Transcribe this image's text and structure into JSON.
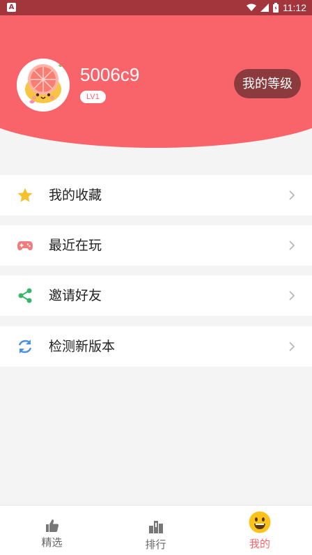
{
  "status_bar": {
    "time": "11:12",
    "notification_icon": "a-app-icon"
  },
  "profile": {
    "username": "5006c9",
    "level": "LV1",
    "level_button": "我的等级",
    "avatar_icon": "grapefruit-avatar"
  },
  "menu": [
    {
      "label": "我的收藏",
      "icon": "star-icon",
      "color": "#f7c12e"
    },
    {
      "label": "最近在玩",
      "icon": "gamepad-icon",
      "color": "#f27b7e"
    },
    {
      "label": "邀请好友",
      "icon": "share-icon",
      "color": "#39b56a"
    },
    {
      "label": "检测新版本",
      "icon": "refresh-icon",
      "color": "#4d8fe0"
    }
  ],
  "tabs": [
    {
      "label": "精选",
      "icon": "thumbs-up-icon",
      "active": false
    },
    {
      "label": "排行",
      "icon": "rank-icon",
      "active": false
    },
    {
      "label": "我的",
      "icon": "smiley-icon",
      "active": true
    }
  ],
  "colors": {
    "brand": "#f9646a",
    "status_bar": "#a2363c",
    "level_button": "#8b3a3d",
    "active_tab": "#f9646a",
    "inactive_tab": "#666666"
  }
}
